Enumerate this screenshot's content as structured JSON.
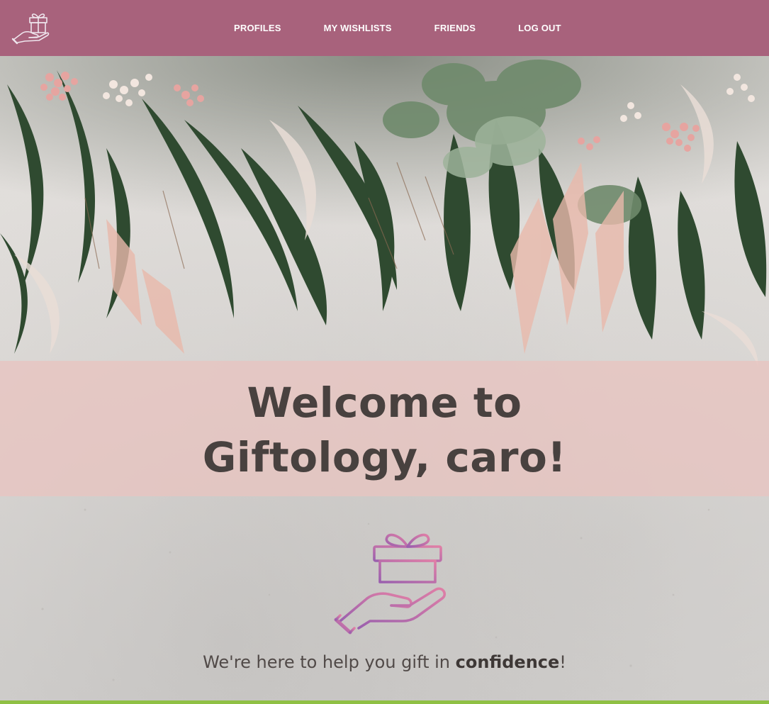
{
  "nav": {
    "links": [
      "PROFILES",
      "MY WISHLISTS",
      "FRIENDS",
      "LOG OUT"
    ]
  },
  "hero": {
    "title": "Welcome to Giftology, caro!",
    "tagline_prefix": "We're here to help you gift in ",
    "tagline_bold": "confidence",
    "tagline_suffix": "!"
  },
  "icons": {
    "logo": "gift-hand-icon",
    "hero": "gift-hand-icon"
  },
  "colors": {
    "navbar": "#a8627c",
    "welcome_band": "#e8c4c0",
    "title_text": "#48413f",
    "icon_gradient_start": "#9a5fae",
    "icon_gradient_end": "#e07fa6",
    "bottom_bar": "#8fc044"
  }
}
